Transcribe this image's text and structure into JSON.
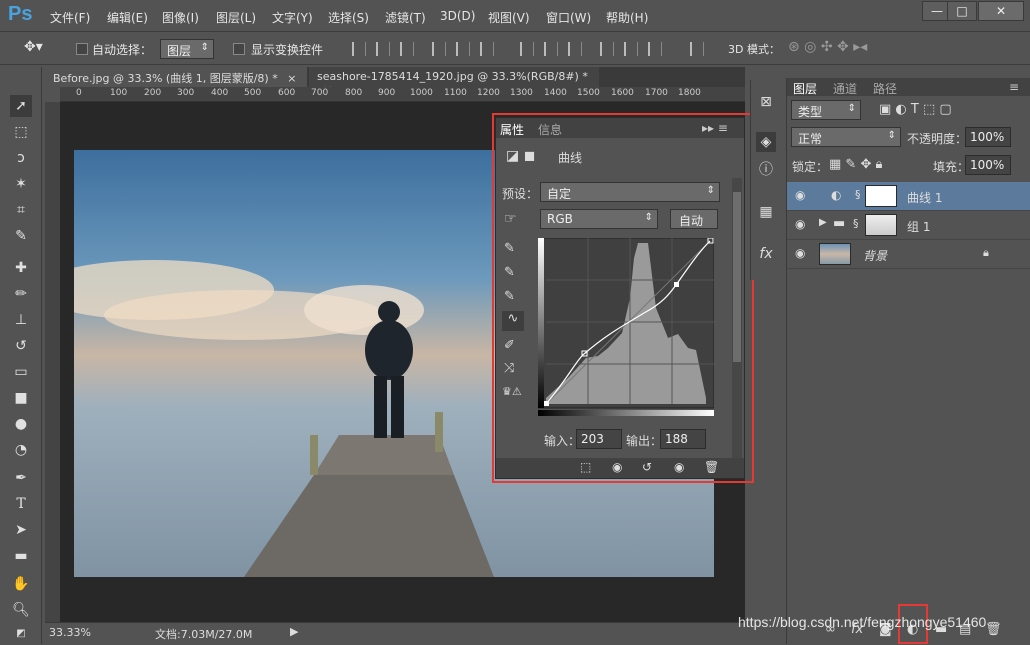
{
  "app": {
    "logo": "Ps"
  },
  "menu": [
    "文件(F)",
    "编辑(E)",
    "图像(I)",
    "图层(L)",
    "文字(Y)",
    "选择(S)",
    "滤镜(T)",
    "3D(D)",
    "视图(V)",
    "窗口(W)",
    "帮助(H)"
  ],
  "window_controls": {
    "minimize": "—",
    "maximize": "□",
    "close": "✕"
  },
  "options": {
    "auto_select_label": "自动选择：",
    "auto_select_value": "图层",
    "show_transform_label": "显示变换控件",
    "mode_3d_label": "3D 模式："
  },
  "tabs": [
    {
      "label": "Before.jpg @ 33.3% (曲线 1, 图层蒙版/8) *",
      "close": "×"
    },
    {
      "label": "seashore-1785414_1920.jpg @ 33.3%(RGB/8#) *",
      "close": "×"
    }
  ],
  "ruler": [
    "0",
    "100",
    "200",
    "300",
    "400",
    "500",
    "600",
    "700",
    "800",
    "900",
    "1000",
    "1100",
    "1200",
    "1300",
    "1400",
    "1500",
    "1600",
    "1700",
    "1800"
  ],
  "status": {
    "zoom": "33.33%",
    "doc": "文档:7.03M/27.0M"
  },
  "properties": {
    "tab_properties": "属性",
    "tab_info": "信息",
    "title": "曲线",
    "preset_label": "预设：",
    "preset_value": "自定",
    "channel_value": "RGB",
    "auto_button": "自动",
    "input_label": "输入：",
    "input_value": "203",
    "output_label": "输出：",
    "output_value": "188"
  },
  "layers": {
    "tab_layers": "图层",
    "tab_channels": "通道",
    "tab_paths": "路径",
    "filter_kind": "类型",
    "blend_mode": "正常",
    "opacity_label": "不透明度：",
    "opacity_value": "100%",
    "lock_label": "锁定：",
    "fill_label": "填充：",
    "fill_value": "100%",
    "rows": [
      {
        "name": "曲线 1"
      },
      {
        "name": "组 1"
      },
      {
        "name": "背景"
      }
    ]
  },
  "watermark": "https://blog.csdn.net/fengzhongye51460",
  "colors": {
    "highlight_outline": "#e53935",
    "selected_layer": "#5b7a9c",
    "ps_blue": "#4aa3df"
  }
}
